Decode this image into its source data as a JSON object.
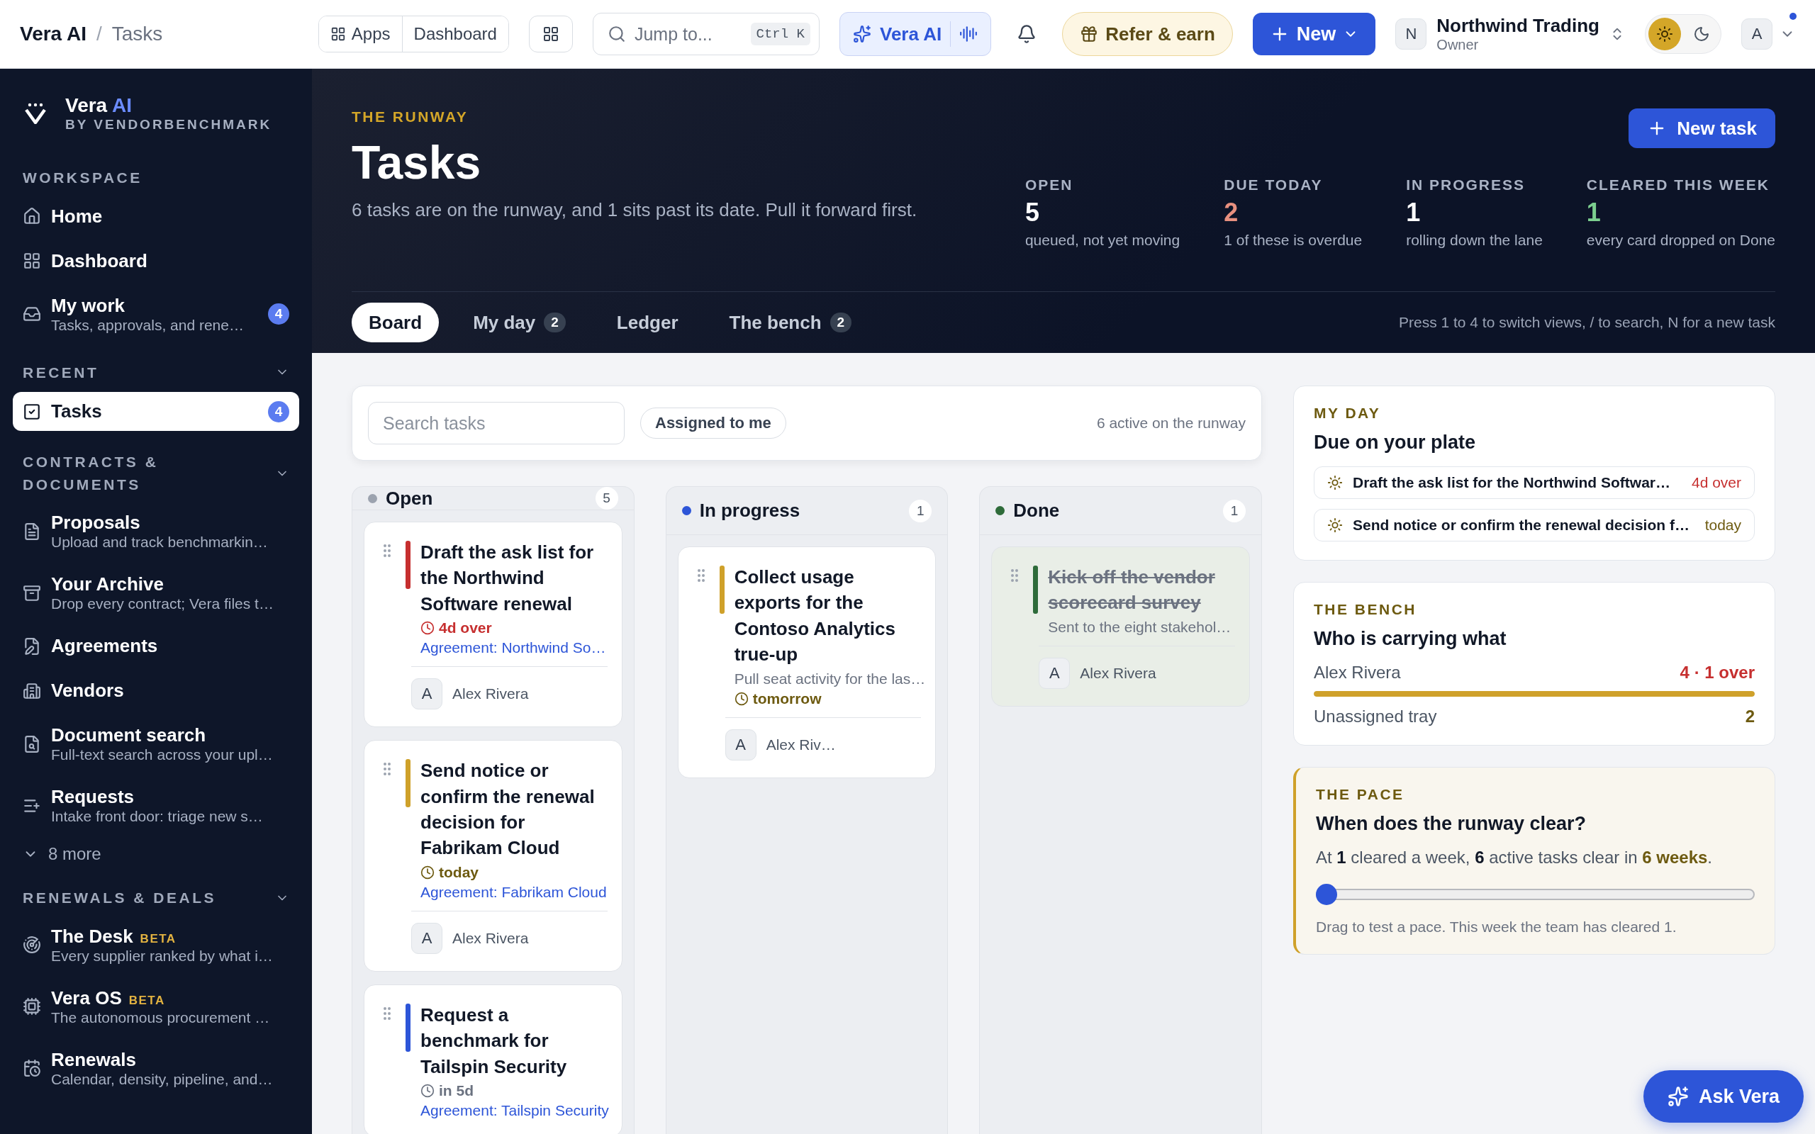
{
  "topbar": {
    "crumbs": [
      "Vera AI",
      "Tasks"
    ],
    "separator": "/",
    "apps": "Apps",
    "dashboard": "Dashboard",
    "search": {
      "placeholder": "Jump to...",
      "shortcut": "Ctrl K"
    },
    "ai": "Vera AI",
    "refer": "Refer & earn",
    "new": "New",
    "org": {
      "initial": "N",
      "name": "Northwind Trading",
      "role": "Owner"
    },
    "dark_mode": false,
    "user": "A",
    "notification": true
  },
  "sidebar": {
    "brand": {
      "name": "Vera",
      "accent": "AI",
      "tagline": "BY VENDORBENCHMARK"
    },
    "sections": [
      {
        "title": "WORKSPACE",
        "collapsible": false,
        "items": [
          {
            "kind": "link",
            "label": "Home",
            "selected": false
          },
          {
            "kind": "link",
            "label": "Dashboard",
            "selected": false
          },
          {
            "kind": "link",
            "label": "My work",
            "subtitle": "Tasks, approvals, and rene…",
            "badge": "4",
            "selected": false
          }
        ]
      },
      {
        "title": "RECENT",
        "collapsible": true,
        "items": [
          {
            "kind": "link",
            "label": "Tasks",
            "badge": "4",
            "selected": true
          }
        ]
      },
      {
        "title": "CONTRACTS & DOCUMENTS",
        "collapsible": true,
        "items": [
          {
            "kind": "link",
            "label": "Proposals",
            "subtitle": "Upload and track benchmarkin…",
            "selected": false
          },
          {
            "kind": "link",
            "label": "Your Archive",
            "subtitle": "Drop every contract; Vera files t…",
            "selected": false
          },
          {
            "kind": "link",
            "label": "Agreements",
            "selected": false
          },
          {
            "kind": "link",
            "label": "Vendors",
            "selected": false
          },
          {
            "kind": "link",
            "label": "Document search",
            "subtitle": "Full-text search across your upl…",
            "selected": false
          },
          {
            "kind": "link",
            "label": "Requests",
            "subtitle": "Intake front door: triage new s…",
            "selected": false
          },
          {
            "kind": "more",
            "label": "8 more"
          }
        ]
      },
      {
        "title": "RENEWALS & DEALS",
        "collapsible": true,
        "items": [
          {
            "kind": "link",
            "label": "The Desk",
            "tag": "BETA",
            "subtitle": "Every supplier ranked by what i…",
            "selected": false
          },
          {
            "kind": "link",
            "label": "Vera OS",
            "tag": "BETA",
            "subtitle": "The autonomous procurement …",
            "selected": false
          },
          {
            "kind": "link",
            "label": "Renewals",
            "subtitle": "Calendar, density, pipeline, and…",
            "selected": false
          }
        ]
      }
    ]
  },
  "header": {
    "eyebrow": "THE RUNWAY",
    "title": "Tasks",
    "summary": "6 tasks are on the runway, and 1 sits past its date. Pull it forward first.",
    "action": "New task",
    "stats": [
      {
        "label": "OPEN",
        "value": "5",
        "note": "queued, not yet moving",
        "color": "#ffffff"
      },
      {
        "label": "DUE TODAY",
        "value": "2",
        "note": "1 of these is overdue",
        "color": "#e8907f"
      },
      {
        "label": "IN PROGRESS",
        "value": "1",
        "note": "rolling down the lane",
        "color": "#ffffff"
      },
      {
        "label": "CLEARED THIS WEEK",
        "value": "1",
        "note": "every card dropped on Done",
        "color": "#7ccf8f"
      }
    ]
  },
  "tabs": [
    {
      "label": "Board",
      "selected": true
    },
    {
      "label": "My day",
      "count": "2",
      "selected": false
    },
    {
      "label": "Ledger",
      "selected": false
    },
    {
      "label": "The bench",
      "count": "2",
      "selected": false
    }
  ],
  "tabs_hint": "Press 1 to 4 to switch views, / to search, N for a new task",
  "toolbar": {
    "search": {
      "placeholder": "Search tasks"
    },
    "filter": {
      "label": "Assigned to me",
      "selected": false
    },
    "summary": "6 active on the runway"
  },
  "columns": [
    {
      "title": "Open",
      "count": "5",
      "color": "#9ca3af",
      "cards": [
        {
          "title": "Draft the ask list for the Northwind Software renewal",
          "color": "#c62f2f",
          "due": {
            "text": "4d over",
            "color": "#c62f2f"
          },
          "link": "Agreement: Northwind So…",
          "assignee_initial": "A",
          "assignee": "Alex Rivera",
          "done": false
        },
        {
          "title": "Send notice or confirm the renewal decision for Fabrikam Cloud",
          "color": "#cfa12a",
          "due": {
            "text": "today",
            "color": "#6d5a10"
          },
          "link": "Agreement: Fabrikam Cloud",
          "assignee_initial": "A",
          "assignee": "Alex Rivera",
          "done": false
        },
        {
          "title": "Request a benchmark for Tailspin Security",
          "color": "#2d55d8",
          "due": {
            "text": "in 5d",
            "color": "#6b7280"
          },
          "link": "Agreement: Tailspin Security",
          "done": false
        }
      ]
    },
    {
      "title": "In progress",
      "count": "1",
      "color": "#2d55d8",
      "cards": [
        {
          "title": "Collect usage exports for the Contoso Analytics true-up",
          "color": "#cfa12a",
          "description": "Pull seat activity for the las…",
          "due": {
            "text": "tomorrow",
            "color": "#6d5a10"
          },
          "assignee_initial": "A",
          "assignee": "Alex Riv…",
          "done": false
        }
      ]
    },
    {
      "title": "Done",
      "count": "1",
      "color": "#2e6b3a",
      "cards": [
        {
          "title": "Kick off the vendor scorecard survey",
          "color": "#2e6b3a",
          "description": "Sent to the eight stakehol…",
          "assignee_initial": "A",
          "assignee": "Alex Rivera",
          "done": true
        }
      ]
    }
  ],
  "my_day": {
    "eyebrow": "MY DAY",
    "title": "Due on your plate",
    "items": [
      {
        "text": "Draft the ask list for the Northwind Softwar…",
        "due": {
          "text": "4d over",
          "color": "#c62f2f"
        }
      },
      {
        "text": "Send notice or confirm the renewal decision f…",
        "due": {
          "text": "today",
          "color": "#6d5a10"
        }
      }
    ]
  },
  "bench": {
    "eyebrow": "THE BENCH",
    "title": "Who is carrying what",
    "rows": [
      {
        "name": "Alex Rivera",
        "value": {
          "text": "4 · 1 over",
          "color": "#c62f2f"
        },
        "level": 1
      },
      {
        "name": "Unassigned tray",
        "value": {
          "text": "2",
          "color": "#6d5a10"
        }
      }
    ]
  },
  "pace": {
    "eyebrow": "THE PACE",
    "title": "When does the runway clear?",
    "sentence": "At **1** cleared a week, **6** active tasks clear in **6 weeks**.",
    "level": 0,
    "hint": "Drag to test a pace. This week the team has cleared 1."
  },
  "assistant": "Ask Vera"
}
